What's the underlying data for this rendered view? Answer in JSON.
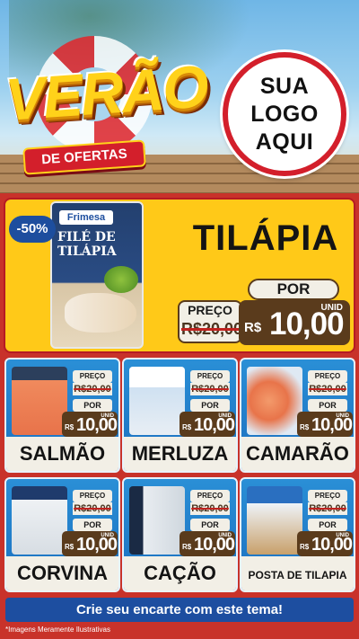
{
  "header": {
    "title": "VERÃO",
    "subtitle": "DE OFERTAS",
    "logo_lines": [
      "SUA",
      "LOGO",
      "AQUI"
    ]
  },
  "featured": {
    "discount": "-50%",
    "brand": "Frimesa",
    "package_name": "FILÉ DE TILÁPIA",
    "name": "TILÁPIA",
    "label_por": "POR",
    "label_preco": "PREÇO",
    "old_price": "R$20,00",
    "currency": "R$",
    "new_price": "10,00",
    "unit": "UNID"
  },
  "products": [
    {
      "name": "SALMÃO",
      "preco_label": "PREÇO",
      "old_price": "R$20,00",
      "por_label": "POR",
      "currency": "R$",
      "new_price": "10,00",
      "unit": "UNID"
    },
    {
      "name": "MERLUZA",
      "preco_label": "PREÇO",
      "old_price": "R$20,00",
      "por_label": "POR",
      "currency": "R$",
      "new_price": "10,00",
      "unit": "UNID"
    },
    {
      "name": "CAMARÃO",
      "preco_label": "PREÇO",
      "old_price": "R$20,00",
      "por_label": "POR",
      "currency": "R$",
      "new_price": "10,00",
      "unit": "UNID"
    },
    {
      "name": "CORVINA",
      "preco_label": "PREÇO",
      "old_price": "R$20,00",
      "por_label": "POR",
      "currency": "R$",
      "new_price": "10,00",
      "unit": "UNID"
    },
    {
      "name": "CAÇÃO",
      "preco_label": "PREÇO",
      "old_price": "R$20,00",
      "por_label": "POR",
      "currency": "R$",
      "new_price": "10,00",
      "unit": "UNID"
    },
    {
      "name": "POSTA DE TILAPIA",
      "preco_label": "PREÇO",
      "old_price": "R$20,00",
      "por_label": "POR",
      "currency": "R$",
      "new_price": "10,00",
      "unit": "UNID"
    }
  ],
  "cta": "Crie seu encarte com este tema!",
  "disclaimer": "*Imagens Meramente Ilustrativas",
  "colors": {
    "background_red": "#c8322a",
    "yellow": "#ffc918",
    "blue_card": "#1b6fbf",
    "brown_price": "#5a3b1c",
    "cta_blue": "#1d4ea0"
  }
}
